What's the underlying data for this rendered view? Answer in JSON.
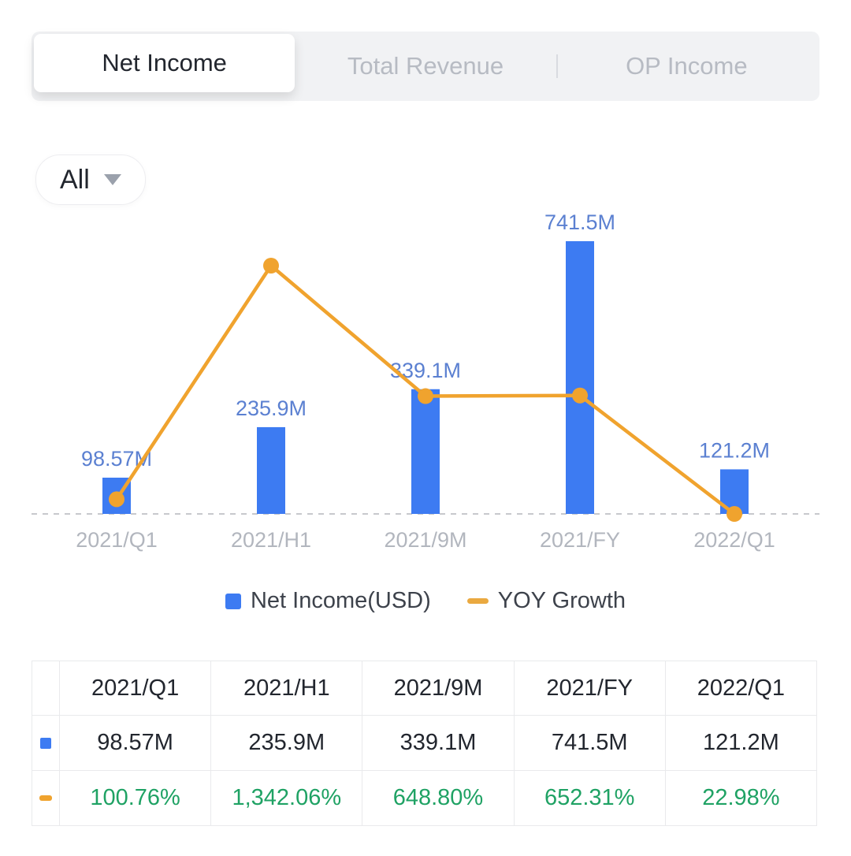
{
  "colors": {
    "bar_blue": "#3d7bf2",
    "label_blue": "#5b80d1",
    "line_orange": "#f0a32e",
    "green": "#1fa264",
    "text_dark": "#22262e",
    "tab_inactive": "#b7bbc3",
    "tabbar_bg": "#f1f2f4",
    "axis_label": "#b2b6be",
    "dashed_line": "#c7c9cd",
    "table_border": "#e9eaec"
  },
  "tabs": {
    "items": [
      {
        "label": "Net Income",
        "active": true
      },
      {
        "label": "Total Revenue",
        "active": false
      },
      {
        "label": "OP Income",
        "active": false
      }
    ]
  },
  "filter": {
    "label": "All"
  },
  "legend": {
    "series1": "Net Income(USD)",
    "series2": "YOY Growth"
  },
  "chart_data": {
    "type": "combo-bar-line",
    "categories": [
      "2021/Q1",
      "2021/H1",
      "2021/9M",
      "2021/FY",
      "2022/Q1"
    ],
    "series": [
      {
        "name": "Net Income(USD)",
        "type": "bar",
        "unit": "USD millions",
        "values": [
          98.57,
          235.9,
          339.1,
          741.5,
          121.2
        ],
        "labels": [
          "98.57M",
          "235.9M",
          "339.1M",
          "741.5M",
          "121.2M"
        ],
        "color": "#3d7bf2"
      },
      {
        "name": "YOY Growth",
        "type": "line",
        "unit": "percent",
        "values": [
          100.76,
          1342.06,
          648.8,
          652.31,
          22.98
        ],
        "labels": [
          "100.76%",
          "1,342.06%",
          "648.80%",
          "652.31%",
          "22.98%"
        ],
        "color": "#f0a32e"
      }
    ],
    "axes": "hidden (no tick axes shown)",
    "baseline": "dashed horizontal zero line under bars",
    "legend_position": "bottom-center",
    "data_label_color": "#5b80d1"
  },
  "table": {
    "headers": [
      "2021/Q1",
      "2021/H1",
      "2021/9M",
      "2021/FY",
      "2022/Q1"
    ],
    "rows": [
      {
        "marker": "bar",
        "values": [
          "98.57M",
          "235.9M",
          "339.1M",
          "741.5M",
          "121.2M"
        ]
      },
      {
        "marker": "line",
        "values": [
          "100.76%",
          "1,342.06%",
          "648.80%",
          "652.31%",
          "22.98%"
        ]
      }
    ]
  }
}
